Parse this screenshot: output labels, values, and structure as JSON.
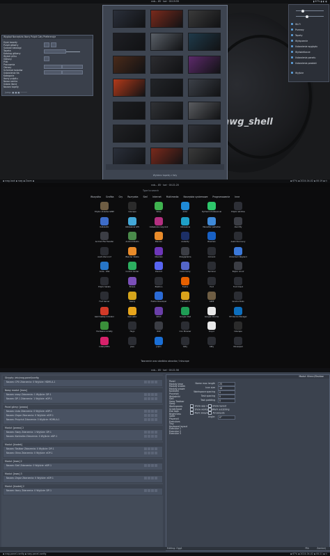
{
  "screens": {
    "wallpaper": {
      "topbar": {
        "center": "nvb... 85 · kwi · 00:19:59",
        "right": "▮ 67% ▮ ◐ ◐"
      },
      "watermark": "nwg_shell",
      "settings_window": {
        "menu": [
          "Wygląd",
          "Narzędzia",
          "Ikony",
          "Pulpit",
          "Cały",
          "Preferencje"
        ],
        "items": [
          "Dysk twardy",
          "Pulpit główny",
          "Surowe katalogi",
          "Tapeta",
          "Katalog główny",
          "Wybór pliku",
          "Główny",
          "Pliki",
          "Pracownia",
          "Obrazy",
          "Schemat kolorów",
          "Ustawienia tła",
          "Kategorie",
          "Ikony pulpitu",
          "Nowa ramka",
          "Ustaw ikonę",
          "Nazwa tapety"
        ],
        "status": "Jump: ■ ■ ■  ─────"
      },
      "picker": {
        "footer": "Wybierz tapetę z listy"
      },
      "quick_menu": {
        "items": [
          "Wi-Fi",
          "Przerwy",
          "Tapety",
          "Wyłączenie",
          "Ustawienia wyglądu",
          "Wyświetlacze",
          "Ustawienia panelu",
          "Ustawienia powłoki",
          "Wyjście"
        ]
      },
      "bottombar": {
        "left": "▪ nwg-look ▪ nwg  ▪ Zoom ▪",
        "right": "▪ 67% ▪ 2024-04-02 ▪ 00:19 ▪ ⏻"
      }
    },
    "launcher": {
      "topbar": "nvb...  85 · kwi · 00:21:20",
      "search_placeholder": "Type to search",
      "categories": [
        "Wszystko",
        "Grafika",
        "Gry",
        "Rozrywka",
        "Sieć",
        "Internet",
        "Multimedia",
        "Narzędzia systemowe",
        "Programowanie",
        "Inne"
      ],
      "apps": [
        {
          "name": "Edytor obrazów GIMP",
          "icon": "gimp-icon",
          "color": "#6e5d43"
        },
        {
          "name": "Inkscape",
          "icon": "inkscape-icon",
          "color": "#2b2b2b"
        },
        {
          "name": "Sklep",
          "icon": "store-icon",
          "color": "#3fb34f"
        },
        {
          "name": "Aktor",
          "icon": "a-icon",
          "color": "#1f8ad6"
        },
        {
          "name": "PyCharm Professional",
          "icon": "pycharm-icon",
          "color": "#2ec66b"
        },
        {
          "name": "Edytor skrótów",
          "icon": "keyboard-icon",
          "color": "#2d2f36"
        },
        {
          "name": "Kalkulator",
          "icon": "calculator-icon",
          "color": "#3d6cc8"
        },
        {
          "name": "Ustawienia GTK",
          "icon": "gtk-icon",
          "color": "#43a8d8"
        },
        {
          "name": "Ustawienia nwg-look",
          "icon": "look-icon",
          "color": "#b32f80"
        },
        {
          "name": "Ustawienia",
          "icon": "settings-icon",
          "color": "#1fa0c8"
        },
        {
          "name": "Menedżer pakietów",
          "icon": "package-icon",
          "color": "#3f8ad8"
        },
        {
          "name": "Alacritty",
          "icon": "terminal-icon",
          "color": "#3b3d44"
        },
        {
          "name": "Android File Transfer",
          "icon": "android-icon",
          "color": "#3b3d44"
        },
        {
          "name": "Android Studio",
          "icon": "android-studio-icon",
          "color": "#4a8a4a"
        },
        {
          "name": "Blender",
          "icon": "blender-icon",
          "color": "#e98b2a"
        },
        {
          "name": "Audacity",
          "icon": "audacity-icon",
          "color": "#1c2f66"
        },
        {
          "name": "Blueman",
          "icon": "bluetooth-icon",
          "color": "#1860c4"
        },
        {
          "name": "Avahi Discovery",
          "icon": "avahi-icon",
          "color": "#2b2d33"
        },
        {
          "name": "Avahi Zeroconf",
          "icon": "avahi-icon",
          "color": "#2b2d33"
        },
        {
          "name": "Blender Stable",
          "icon": "blender-icon",
          "color": "#e98b2a"
        },
        {
          "name": "Obsidian",
          "icon": "obsidian-icon",
          "color": "#6d36b8"
        },
        {
          "name": "Przeglądarka",
          "icon": "browser-icon",
          "color": "#3b3d44"
        },
        {
          "name": "Czcionki",
          "icon": "fonts-icon",
          "color": "#2b2d33"
        },
        {
          "name": "Chromium Wayland",
          "icon": "chromium-icon",
          "color": "#3b78d8"
        },
        {
          "name": "Code - OSS",
          "icon": "code-icon",
          "color": "#2775c7"
        },
        {
          "name": "Control Center",
          "icon": "control-icon",
          "color": "#2cae5f"
        },
        {
          "name": "Discord",
          "icon": "discord-icon",
          "color": "#5865f2"
        },
        {
          "name": "Dokumenty",
          "icon": "docs-icon",
          "color": "#5466c8"
        },
        {
          "name": "Terminal",
          "icon": "terminal-icon",
          "color": "#2b2d33"
        },
        {
          "name": "Edytor dconf",
          "icon": "dconf-icon",
          "color": "#3b3d44"
        },
        {
          "name": "Edytor tekstu",
          "icon": "text-editor-icon",
          "color": "#2b2d33"
        },
        {
          "name": "Emacs",
          "icon": "emacs-icon",
          "color": "#7a4fb8"
        },
        {
          "name": "Elektron",
          "icon": "electron-icon",
          "color": "#2b2d33"
        },
        {
          "name": "Firefox",
          "icon": "firefox-icon",
          "color": "#e66000"
        },
        {
          "name": "Foot",
          "icon": "foot-icon",
          "color": "#2b2d33"
        },
        {
          "name": "Foot Client",
          "icon": "foot-icon",
          "color": "#2b2d33"
        },
        {
          "name": "Foot Server",
          "icon": "foot-icon",
          "color": "#2b2d33"
        },
        {
          "name": "Geany",
          "icon": "geany-icon",
          "color": "#d4a41b"
        },
        {
          "name": "Firefox Developer",
          "icon": "firefox-icon",
          "color": "#2b6bd6"
        },
        {
          "name": "Flameshot",
          "icon": "flameshot-icon",
          "color": "#d9a21b"
        },
        {
          "name": "GIMP",
          "icon": "gimp-icon",
          "color": "#6e5d43"
        },
        {
          "name": "Gnome Disks",
          "icon": "disk-icon",
          "color": "#2b2d33"
        },
        {
          "name": "Gammastep Indicator",
          "icon": "gammastep-icon",
          "color": "#d23a28"
        },
        {
          "name": "Galculator",
          "icon": "galculator-icon",
          "color": "#e8a51c"
        },
        {
          "name": "GPick",
          "icon": "gpick-icon",
          "color": "#6a3fa8"
        },
        {
          "name": "Google Chat",
          "icon": "chat-icon",
          "color": "#1f9d55"
        },
        {
          "name": "Google Chrome",
          "icon": "chrome-icon",
          "color": "#e8e8e8"
        },
        {
          "name": "HP Device Manager",
          "icon": "hp-icon",
          "color": "#0d6ebd"
        },
        {
          "name": "Hardware Locality",
          "icon": "hwloc-icon",
          "color": "#3a8f3a"
        },
        {
          "name": "Hugo",
          "icon": "hugo-icon",
          "color": "#2b2d33"
        },
        {
          "name": "IDLE",
          "icon": "idle-icon",
          "color": "#3b3d44"
        },
        {
          "name": "Icon Browser",
          "icon": "icon-browser-icon",
          "color": "#2b2d33"
        },
        {
          "name": "Insync",
          "icon": "insync-icon",
          "color": "#e8e8e8"
        },
        {
          "name": "Inkscape",
          "icon": "inkscape-icon",
          "color": "#2b2b2b"
        },
        {
          "name": "IntelliJ IDEA",
          "icon": "intellij-icon",
          "color": "#d8226b"
        },
        {
          "name": "Java",
          "icon": "java-icon",
          "color": "#2b2d33"
        },
        {
          "name": "Joplin",
          "icon": "joplin-icon",
          "color": "#1a6fd6"
        },
        {
          "name": "Kitty",
          "icon": "kitty-icon",
          "color": "#2b2d33"
        },
        {
          "name": "Kitty",
          "icon": "kitty-icon",
          "color": "#2b2d33"
        },
        {
          "name": "Mousepad",
          "icon": "mousepad-icon",
          "color": "#2b2d33"
        }
      ],
      "footer": "Tworzenie oraz obróbka obrazów / Inkscape"
    },
    "panel_config": {
      "topbar": "nvb...  85 · kwi · 00:21:56",
      "window_title": "Moduł: Klienci/Taskbar",
      "groups": [
        {
          "title": "Skrypty: /etc/nwg-panel/config",
          "rows": [
            "Nazwa: CPU  Zdarzenia: 0  Wyjście: HDMI-A-1"
          ]
        },
        {
          "title": "Nowy moduł: [lewo]",
          "rows": [
            "Nazwa: sway  Zdarzenia: 1  Wyjście: DP-1",
            "Nazwa: DP-1  Zdarzenia: 1  Wyjście: eDP-1"
          ]
        },
        {
          "title": "Panel górny: [prawo]",
          "rows": [
            "Nazwa: Lista  Zdarzenia: 0  Wyjście: eDP-1",
            "Nazwa: Zegar  Zdarzenia: 0  Wyjście: eDP-1",
            "Nazwa: Przycisk  Zdarzenia: 0  Wyjście: HDMI-A-1"
          ]
        },
        {
          "title": "Moduł: [prawo] 2",
          "rows": [
            "Nazwa: Sway  Zdarzenia: 1  Wyjście: DP-1",
            "Nazwa: Kontrolka  Zdarzenia: 0  Wyjście: eDP-1"
          ]
        },
        {
          "title": "Moduł: [środek]",
          "rows": [
            "Nazwa: Taskbar  Zdarzenia: 0  Wyjście: DP-1",
            "Nazwa: Okno  Zdarzenia: 0  Wyjście: eDP-1"
          ]
        },
        {
          "title": "Moduł: [lewo] 2",
          "rows": [
            "Nazwa: Sieć  Zdarzenia: 0  Wyjście: eDP-1"
          ]
        },
        {
          "title": "Moduł: [lewo] 3",
          "rows": [
            "Nazwa: Zegar  Zdarzenia: 0  Wyjście: eDP-1"
          ]
        },
        {
          "title": "Moduł: [środek] 2",
          "rows": [
            "Nazwa: Ikony  Zdarzenia: 0  Wyjście: DP-1"
          ]
        }
      ],
      "sidebar": [
        "Panel",
        "Moduły lewe",
        "Moduły środek",
        "Moduły prawe",
        "Kontrolki",
        "Przyciski",
        "Wskaźniki",
        "Sieć",
        "Sway Taskbar",
        "Sway Workspaces",
        "Scratchpad",
        "Dwl tags",
        "Brightness slider",
        "Playerctl",
        "Executors",
        "Tray",
        "Keyboard layout",
        "Executor 1",
        "Executor 2",
        "Executor 3"
      ],
      "form": [
        {
          "label": "Name max length",
          "value": "25"
        },
        {
          "label": "Icon size",
          "value": "16"
        },
        {
          "label": "Workspace spacing",
          "value": "0"
        },
        {
          "label": "Task spacing",
          "value": "0"
        },
        {
          "label": "Task padding",
          "value": "0"
        }
      ],
      "checks": [
        "Show app name",
        "Show layout",
        "Show workspace",
        "Mark autotiling",
        "Mark xwayland",
        "All outputs",
        "Mark content"
      ],
      "angle_label": "Angle:",
      "angle_value": "0°",
      "status": {
        "left": "Editing: Ogg1",
        "mid": "Plik",
        "right": "Zamknij"
      },
      "bottombar": {
        "left": "▪ nwg-panel-config ▪ nwg-panel-config",
        "right": "▪ 67% ▪ 2024-04-02 ▪ 00:21 ▪ ⏻"
      }
    }
  }
}
